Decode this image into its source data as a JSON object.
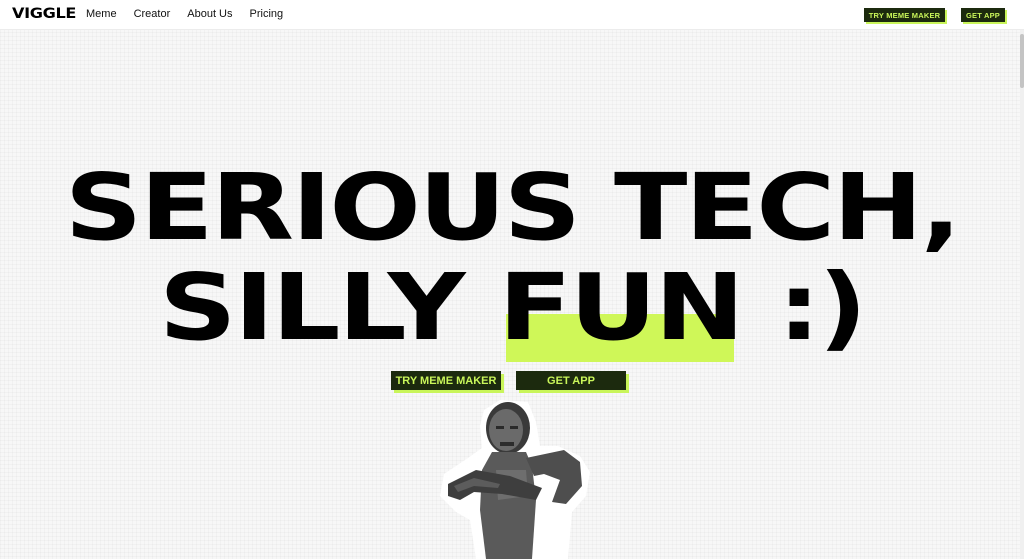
{
  "nav": {
    "logo": "VIGGLE",
    "links": [
      "Meme",
      "Creator",
      "About Us",
      "Pricing"
    ],
    "try_button": "TRY MEME MAKER",
    "app_button": "GET APP"
  },
  "hero": {
    "line1": "SERIOUS TECH,",
    "line2": "SILLY FUN :)",
    "highlight_word": "FUN",
    "highlight_color": "#cff758",
    "try_button": "TRY MEME MAKER",
    "app_button": "GET APP"
  },
  "colors": {
    "button_bg": "#1c2a0e",
    "button_text": "#c9f55a",
    "button_shadow": "#c9f55a"
  },
  "media": {
    "figure_icon": "dancing-man-sticker"
  }
}
